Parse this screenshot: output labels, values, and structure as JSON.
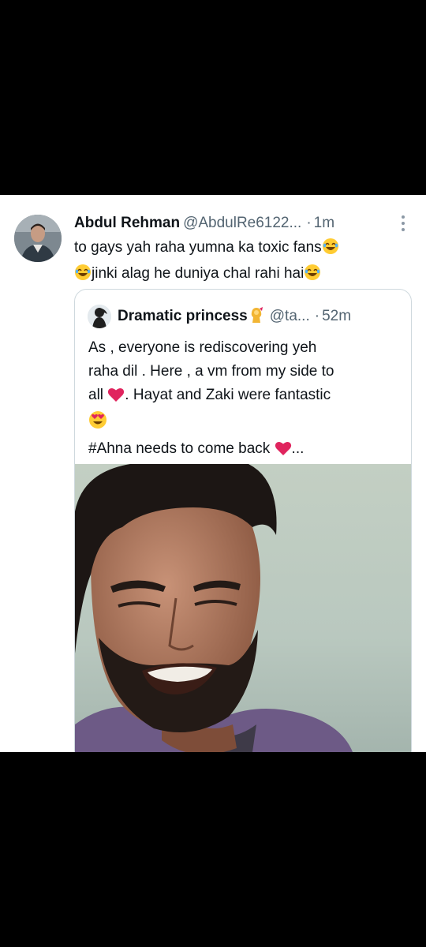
{
  "tweet": {
    "author_name": "Abdul Rehman",
    "author_handle": "@AbdulRe6122...",
    "separator": "·",
    "time": "1m",
    "text_line1": "to gays yah raha yumna ka toxic fans",
    "text_line2": "jinki alag he duniya chal rahi hai",
    "avatar_icon": "person-avatar-icon",
    "more_icon": "vertical-dots-icon"
  },
  "quoted_tweet": {
    "author_name": "Dramatic princess",
    "author_handle": "@ta...",
    "separator": "·",
    "time": "52m",
    "line1": "As , everyone is rediscovering yeh",
    "line2": "raha dil . Here , a vm from my side to",
    "line3_a": "all",
    "line3_b": ". Hayat and Zaki were fantastic",
    "line5_a": "#Ahna needs to come back",
    "line5_b": "...",
    "media_icon": "video-thumbnail-man-smiling"
  },
  "colors": {
    "background": "#000000",
    "card": "#ffffff",
    "text": "#0f1419",
    "muted": "#536471",
    "border": "#cfd9de",
    "heart": "#e0245e"
  }
}
